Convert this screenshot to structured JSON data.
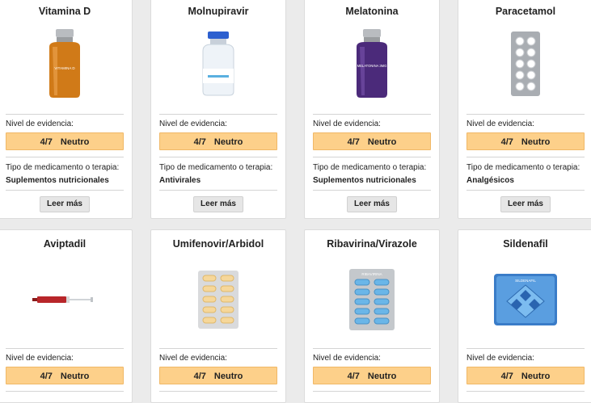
{
  "labels": {
    "evidence": "Nivel de evidencia:",
    "therapy_type": "Tipo de medicamento o terapia:",
    "read_more": "Leer más"
  },
  "cards": [
    {
      "name": "Vitamina D",
      "score": "4/7",
      "verdict": "Neutro",
      "type": "Suplementos nutricionales",
      "image_label": "VITAMINA D",
      "image": "amber-vial-icon"
    },
    {
      "name": "Molnupiravir",
      "score": "4/7",
      "verdict": "Neutro",
      "type": "Antivirales",
      "image": "clear-vial-icon"
    },
    {
      "name": "Melatonina",
      "score": "4/7",
      "verdict": "Neutro",
      "type": "Suplementos nutricionales",
      "image_label": "MELATONINA 3MG",
      "image": "purple-vial-icon"
    },
    {
      "name": "Paracetamol",
      "score": "4/7",
      "verdict": "Neutro",
      "type": "Analgésicos",
      "image": "white-pill-blister-icon"
    },
    {
      "name": "Aviptadil",
      "score": "4/7",
      "verdict": "Neutro",
      "image": "syringe-icon"
    },
    {
      "name": "Umifenovir/Arbidol",
      "score": "4/7",
      "verdict": "Neutro",
      "image": "yellow-pill-blister-icon"
    },
    {
      "name": "Ribavirina/Virazole",
      "score": "4/7",
      "verdict": "Neutro",
      "image_label": "RIBAVIRINA",
      "image": "blue-pill-blister-icon"
    },
    {
      "name": "Sildenafil",
      "score": "4/7",
      "verdict": "Neutro",
      "image_label": "SILDENAFIL",
      "image": "blue-pill-box-icon"
    }
  ],
  "colors": {
    "evidence_bg": "#fdd08a",
    "background": "#ebebeb"
  }
}
